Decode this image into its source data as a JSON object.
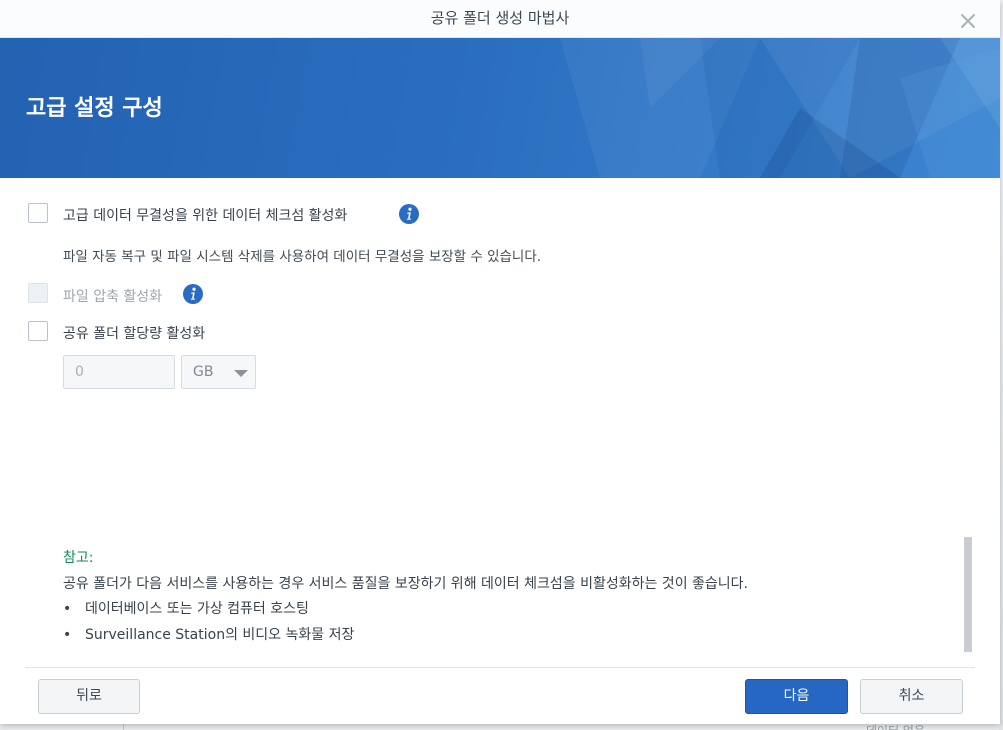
{
  "window": {
    "title": "공유 폴더 생성 마법사"
  },
  "banner": {
    "title": "고급 설정 구성"
  },
  "options": {
    "checksum": {
      "label": "고급 데이터 무결성을 위한 데이터 체크섬 활성화",
      "description": "파일 자동 복구 및 파일 시스템 삭제를 사용하여 데이터 무결성을 보장할 수 있습니다.",
      "checked": false
    },
    "compression": {
      "label": "파일 압축 활성화",
      "checked": false,
      "enabled": false
    },
    "quota": {
      "label": "공유 폴더 할당량 활성화",
      "checked": false,
      "value": "0",
      "unit": "GB"
    }
  },
  "note": {
    "title": "참고:",
    "body": "공유 폴더가 다음 서비스를 사용하는 경우 서비스 품질을 보장하기 위해 데이터 체크섬을 비활성화하는 것이 좋습니다.",
    "bullets": [
      "데이터베이스 또는 가상 컴퓨터 호스팅",
      "Surveillance Station의 비디오 녹화물 저장"
    ]
  },
  "footer": {
    "back_label": "뒤로",
    "next_label": "다음",
    "cancel_label": "취소"
  },
  "background": {
    "partial_text": "데이터 없음"
  },
  "colors": {
    "banner": "#2462b2",
    "primary_button": "#2567c2",
    "info_icon": "#2a6bc4",
    "note_title": "#0f8a5f"
  },
  "icons": {
    "close": "close-icon",
    "info": "info-icon",
    "dropdown": "chevron-down-icon"
  }
}
